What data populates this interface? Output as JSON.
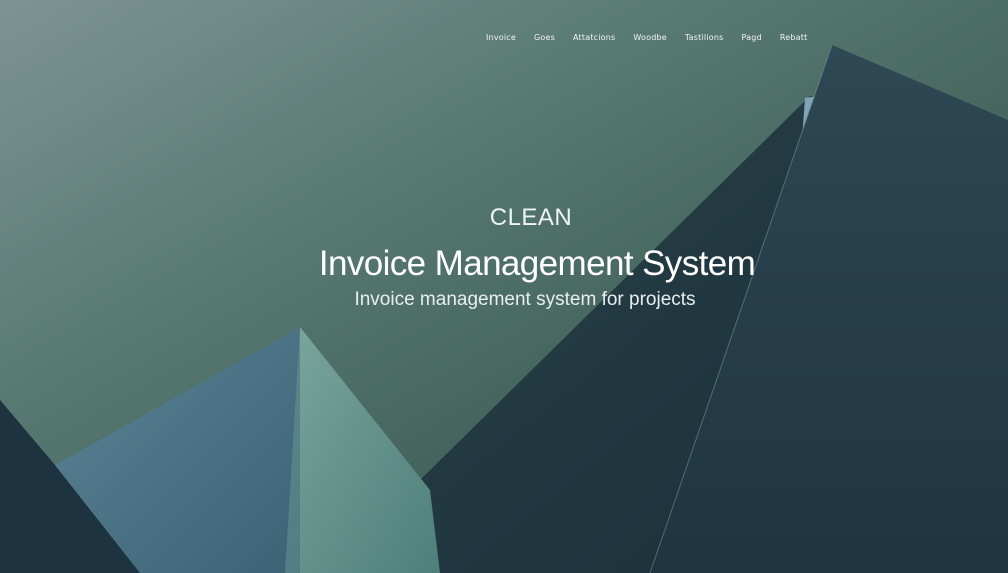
{
  "nav": {
    "items": [
      {
        "label": "Invoice"
      },
      {
        "label": "Goes"
      },
      {
        "label": "Attatcions"
      },
      {
        "label": "Woodbe"
      },
      {
        "label": "Tastilions"
      },
      {
        "label": "Pagd"
      },
      {
        "label": "Rebatt"
      }
    ]
  },
  "hero": {
    "eyebrow": "CLEAN",
    "title": "Invoice Management System",
    "subtitle": "Invoice management system for projects"
  },
  "colors": {
    "background_top": "#5a7575",
    "background_mid": "#49685f",
    "dark_slate": "#223845",
    "teal_panel": "#5b8a85",
    "accent_blue": "#4b728b"
  }
}
